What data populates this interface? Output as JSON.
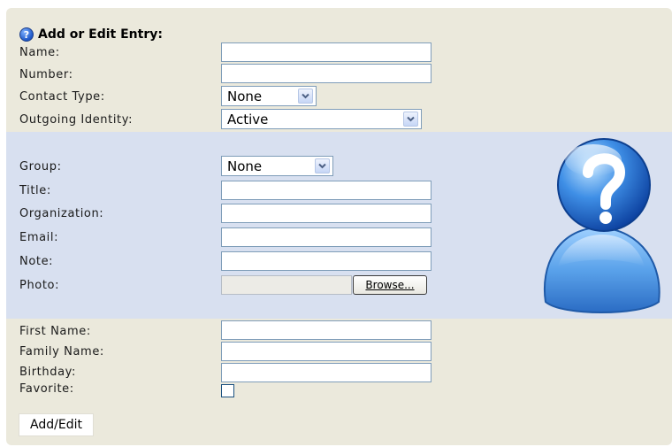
{
  "form": {
    "title": "Add or Edit Entry:",
    "fields": {
      "name": {
        "label": "Name:",
        "value": ""
      },
      "number": {
        "label": "Number:",
        "value": ""
      },
      "contact_type": {
        "label": "Contact Type:",
        "selected": "None"
      },
      "outgoing_identity": {
        "label": "Outgoing Identity:",
        "selected": "Active"
      },
      "group": {
        "label": "Group:",
        "selected": "None"
      },
      "title": {
        "label": "Title:",
        "value": ""
      },
      "organization": {
        "label": "Organization:",
        "value": ""
      },
      "email": {
        "label": "Email:",
        "value": ""
      },
      "note": {
        "label": "Note:",
        "value": ""
      },
      "photo": {
        "label": "Photo:",
        "browse_label": "Browse..."
      },
      "first_name": {
        "label": "First Name:",
        "value": ""
      },
      "family_name": {
        "label": "Family Name:",
        "value": ""
      },
      "birthday": {
        "label": "Birthday:",
        "value": ""
      },
      "favorite": {
        "label": "Favorite:",
        "checked": false
      }
    },
    "submit_label": "Add/Edit"
  },
  "icons": {
    "help": "help-icon",
    "avatar": "unknown-user-avatar-icon"
  },
  "colors": {
    "panel_background": "#ebe9dc",
    "highlight_band": "#d8e0f0",
    "input_border": "#7f9db9"
  }
}
